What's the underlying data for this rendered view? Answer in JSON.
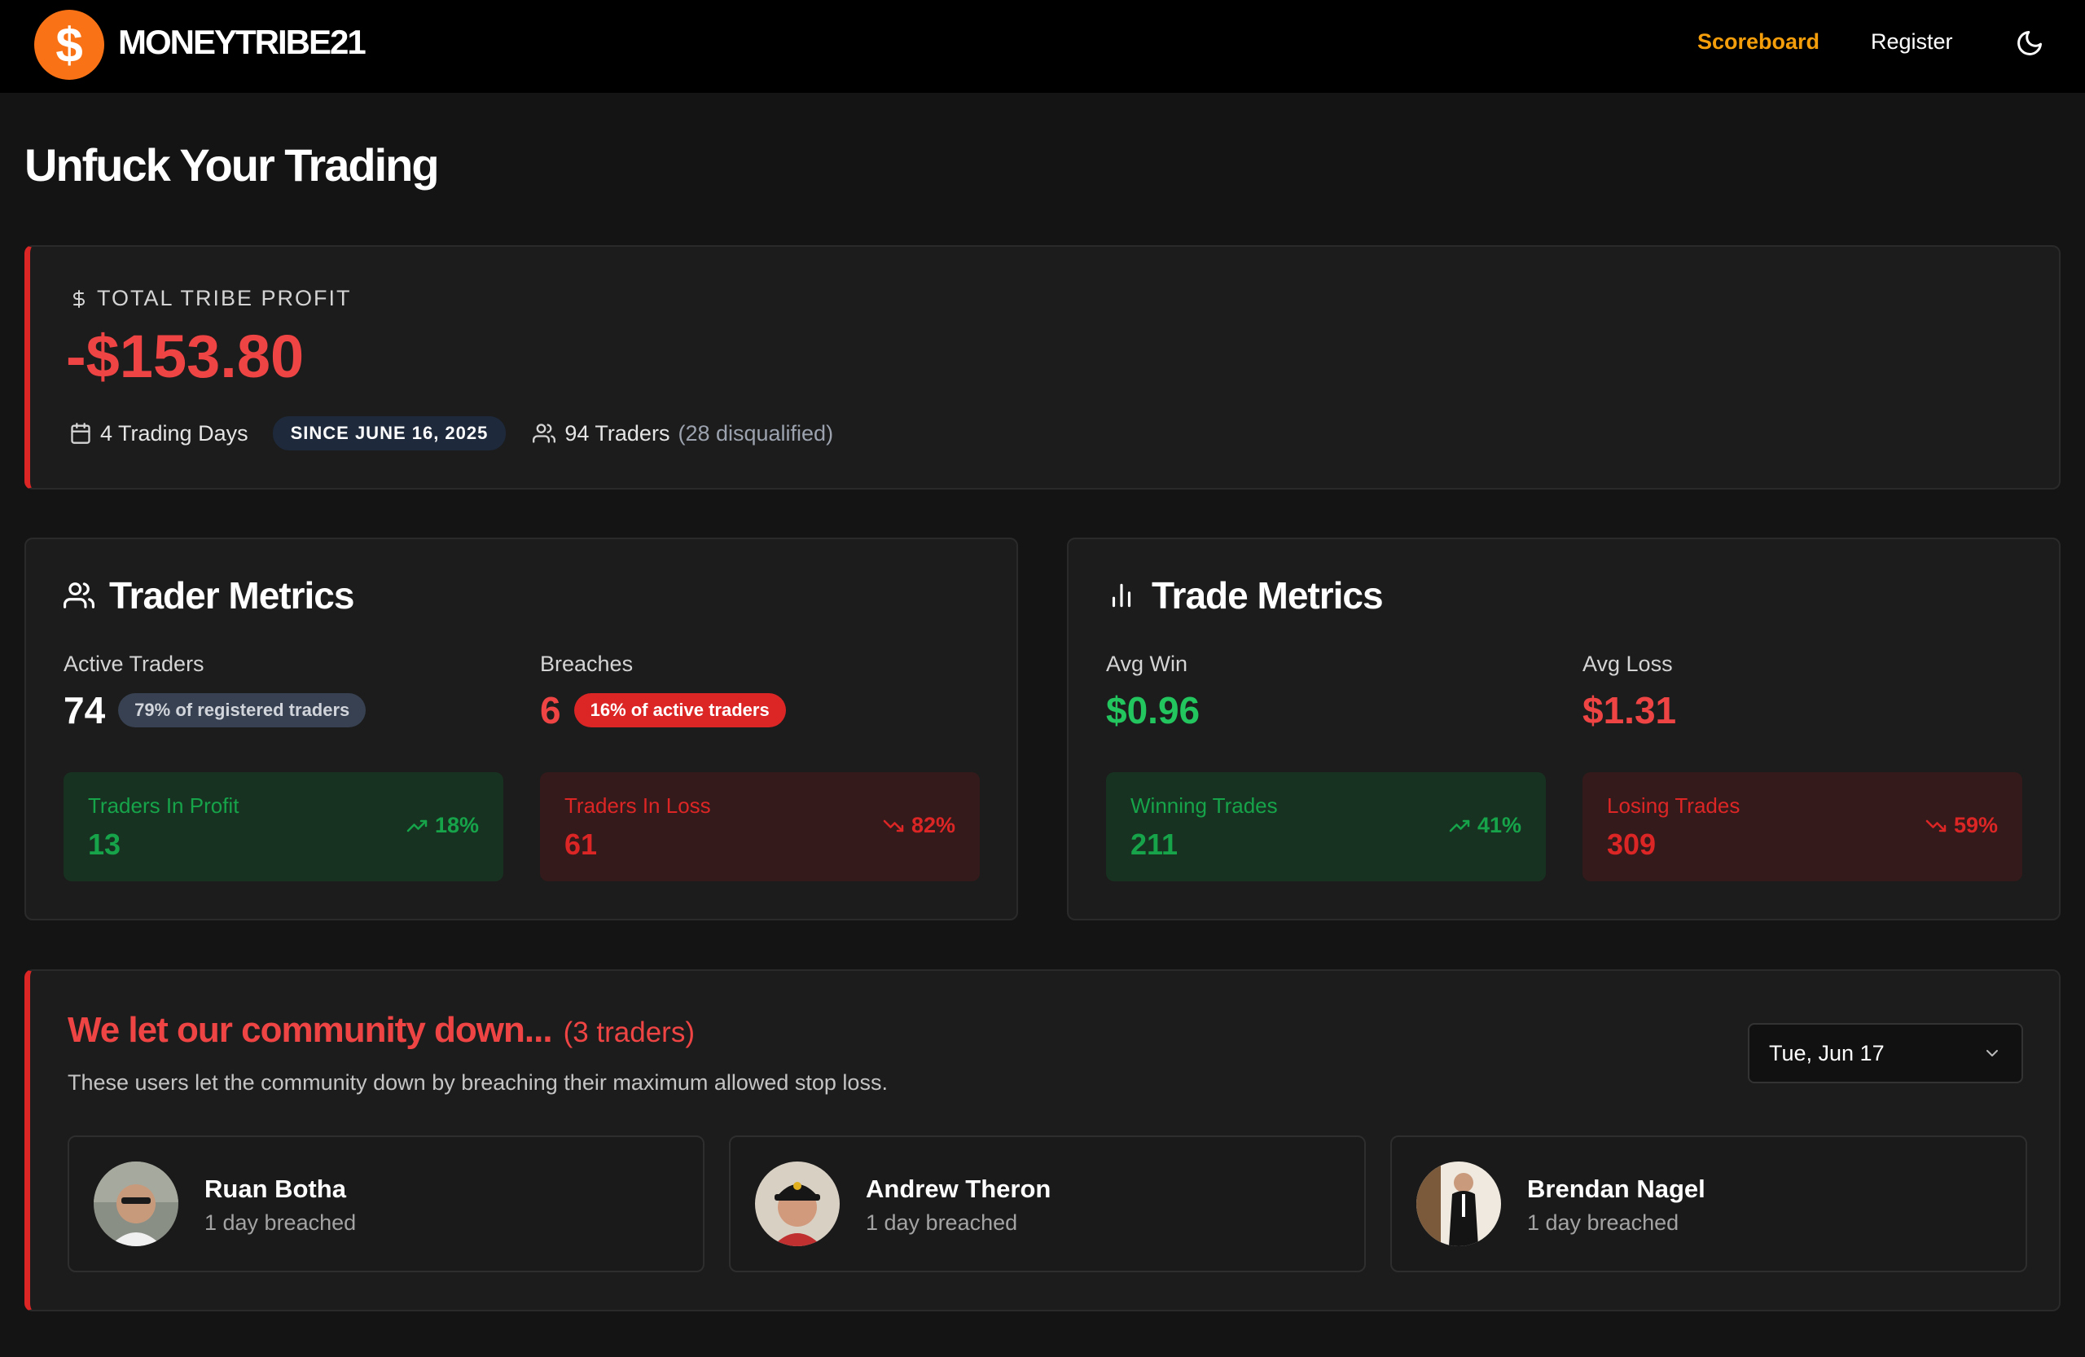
{
  "nav": {
    "brand": "MONEYTRIBE21",
    "logo_symbol": "$",
    "links": {
      "scoreboard": "Scoreboard",
      "register": "Register"
    },
    "theme_icon": "moon-icon"
  },
  "page": {
    "title": "Unfuck Your Trading"
  },
  "profit": {
    "label": "TOTAL TRIBE PROFIT",
    "value": "-$153.80",
    "trading_days": "4 Trading Days",
    "since": "SINCE JUNE 16, 2025",
    "traders": "94 Traders",
    "disqualified": "(28 disqualified)"
  },
  "trader_metrics": {
    "title": "Trader Metrics",
    "active_label": "Active Traders",
    "active_value": "74",
    "active_pill": "79% of registered traders",
    "breaches_label": "Breaches",
    "breaches_value": "6",
    "breaches_pill": "16% of active traders",
    "profit_tile": {
      "label": "Traders In Profit",
      "value": "13",
      "pct": "18%"
    },
    "loss_tile": {
      "label": "Traders In Loss",
      "value": "61",
      "pct": "82%"
    }
  },
  "trade_metrics": {
    "title": "Trade Metrics",
    "avg_win_label": "Avg Win",
    "avg_win_value": "$0.96",
    "avg_loss_label": "Avg Loss",
    "avg_loss_value": "$1.31",
    "win_tile": {
      "label": "Winning Trades",
      "value": "211",
      "pct": "41%"
    },
    "loss_tile": {
      "label": "Losing Trades",
      "value": "309",
      "pct": "59%"
    }
  },
  "community": {
    "title": "We let our community down...",
    "count": "(3 traders)",
    "description": "These users let the community down by breaching their maximum allowed stop loss.",
    "date": "Tue, Jun 17",
    "people": [
      {
        "name": "Ruan Botha",
        "status": "1 day breached"
      },
      {
        "name": "Andrew Theron",
        "status": "1 day breached"
      },
      {
        "name": "Brendan Nagel",
        "status": "1 day breached"
      }
    ]
  },
  "colors": {
    "accent": "#f59e0b",
    "logo": "#f97316",
    "negative": "#ef4444",
    "positive": "#22c55e",
    "background": "#141414"
  }
}
